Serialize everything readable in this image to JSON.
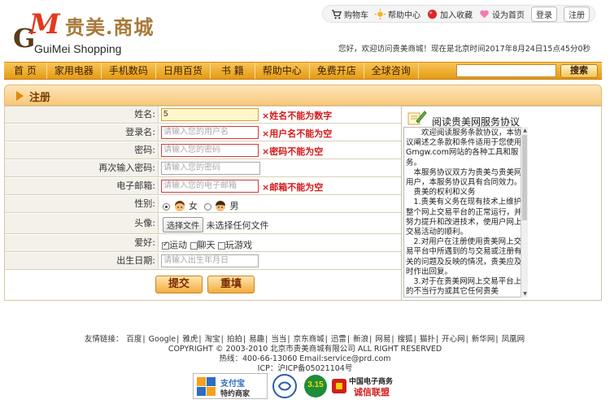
{
  "logo": {
    "mark_g": "G",
    "mark_m": "M",
    "cn": "贵美.商城",
    "en": "GuiMei Shopping"
  },
  "toplinks": {
    "cart": "购物车",
    "help": "帮助中心",
    "favorite": "加入收藏",
    "homepage": "设为首页",
    "login": "登录",
    "register": "注册"
  },
  "welcome": "您好，欢迎访问贵美商城！现在是北京时间2017年8月24日15点45分0秒",
  "nav": {
    "items": [
      "首 页",
      "家用电器",
      "手机数码",
      "日用百货",
      "书  籍",
      "帮助中心",
      "免费开店",
      "全球咨询"
    ],
    "search_value": "",
    "search_button": "搜索"
  },
  "page_title": "注册",
  "form": {
    "name": {
      "label": "姓名:",
      "value": "5",
      "error": "×姓名不能为数字"
    },
    "username": {
      "label": "登录名:",
      "placeholder": "请输入您的用户名",
      "error": "×用户名不能为空"
    },
    "password": {
      "label": "密码:",
      "placeholder": "请输入您的密码",
      "error": "×密码不能为空"
    },
    "password2": {
      "label": "再次输入密码:",
      "placeholder": "请输入您的密码"
    },
    "email": {
      "label": "电子邮箱:",
      "placeholder": "请输入您的电子邮箱",
      "error": "×邮箱不能为空"
    },
    "gender": {
      "label": "性别:",
      "female": "女",
      "male": "男",
      "selected": "女"
    },
    "avatar": {
      "label": "头像:",
      "button": "选择文件",
      "status": "未选择任何文件"
    },
    "hobby": {
      "label": "爱好:",
      "options": [
        "运动",
        "聊天",
        "玩游戏"
      ],
      "checked": [
        "运动"
      ]
    },
    "birthday": {
      "label": "出生日期:",
      "placeholder": "请输入出生年月日"
    },
    "submit": "提交",
    "reset": "重填"
  },
  "agreement": {
    "title": "阅读贵美网服务协议",
    "paragraphs": [
      "欢迎阅读服务条款协议，本协议阐述之条款和条件适用于您使用Gmgw.com网站的各种工具和服务。",
      "本服务协议双方为贵美与贵美网用户，本服务协议具有合同效力。",
      "贵美的权利和义务",
      "1.贵美有义务在现有技术上维护整个网上交易平台的正常运行，并努力提升和改进技术，使用户网上交易活动的顺利。",
      "2.对用户在注册使用贵美网上交易平台中所遇到的与交易或注册有关的问题及反映的情况，贵美应及时作出回复。",
      "3.对于在贵美网网上交易平台上的不当行为或其它任何贵美"
    ]
  },
  "footer": {
    "friend_label": "友情链接：",
    "links": [
      "百度",
      "Google",
      "雅虎",
      "淘宝",
      "拍拍",
      "易趣",
      "当当",
      "京东商城",
      "迅雷",
      "新浪",
      "网易",
      "搜狐",
      "猫扑",
      "开心网",
      "新华网",
      "凤凰网"
    ],
    "copyright": "COPYRIGHT © 2003-2010 北京市贵美商城有限公司 ALL RIGHT RESERVED",
    "contact": "热线：400-66-13060 Email:service@prd.com",
    "icp": "ICP：沪ICP备05021104号",
    "badges": {
      "alipay_line1": "支付宝",
      "alipay_line2": "特约商家",
      "cnnic_315": "3.15",
      "ecom_line1": "中国电子商务",
      "ecom_line2": "诚信联盟"
    }
  },
  "colors": {
    "accent": "#f0a224",
    "error": "#d41a1a",
    "nav_text": "#3a1d00",
    "title": "#7a3c00"
  }
}
